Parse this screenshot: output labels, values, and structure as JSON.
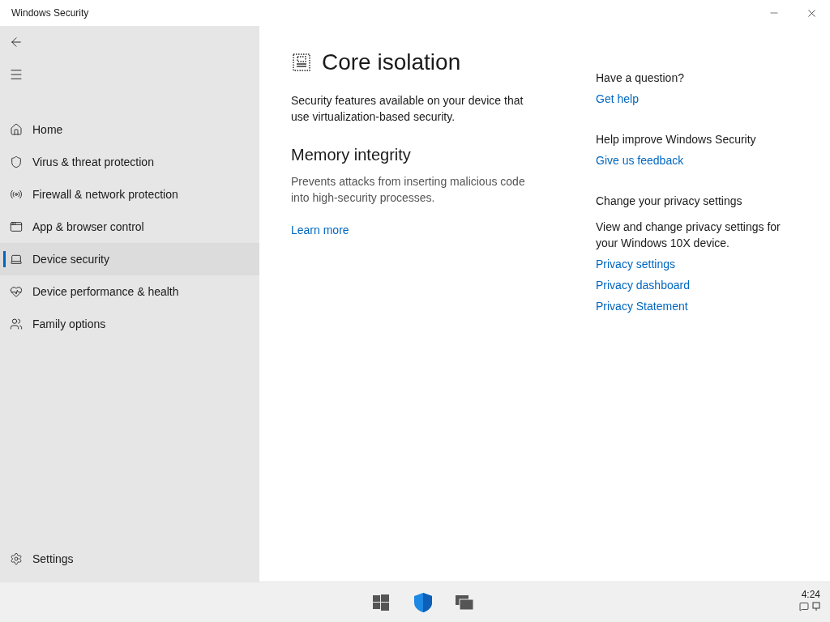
{
  "window": {
    "title": "Windows Security"
  },
  "sidebar": {
    "items": [
      {
        "label": "Home",
        "selected": false
      },
      {
        "label": "Virus & threat protection",
        "selected": false
      },
      {
        "label": "Firewall & network protection",
        "selected": false
      },
      {
        "label": "App & browser control",
        "selected": false
      },
      {
        "label": "Device security",
        "selected": true
      },
      {
        "label": "Device performance & health",
        "selected": false
      },
      {
        "label": "Family options",
        "selected": false
      }
    ],
    "settings": "Settings"
  },
  "page": {
    "title": "Core isolation",
    "description": "Security features available on your device that use virtualization-based security.",
    "section": {
      "title": "Memory integrity",
      "description": "Prevents attacks from inserting malicious code into high-security processes.",
      "link": "Learn more"
    }
  },
  "aside": [
    {
      "title": "Have a question?",
      "links": [
        "Get help"
      ]
    },
    {
      "title": "Help improve Windows Security",
      "links": [
        "Give us feedback"
      ]
    },
    {
      "title": "Change your privacy settings",
      "text": "View and change privacy settings for your Windows 10X device.",
      "links": [
        "Privacy settings",
        "Privacy dashboard",
        "Privacy Statement"
      ]
    }
  ],
  "taskbar": {
    "time": "4:24"
  }
}
